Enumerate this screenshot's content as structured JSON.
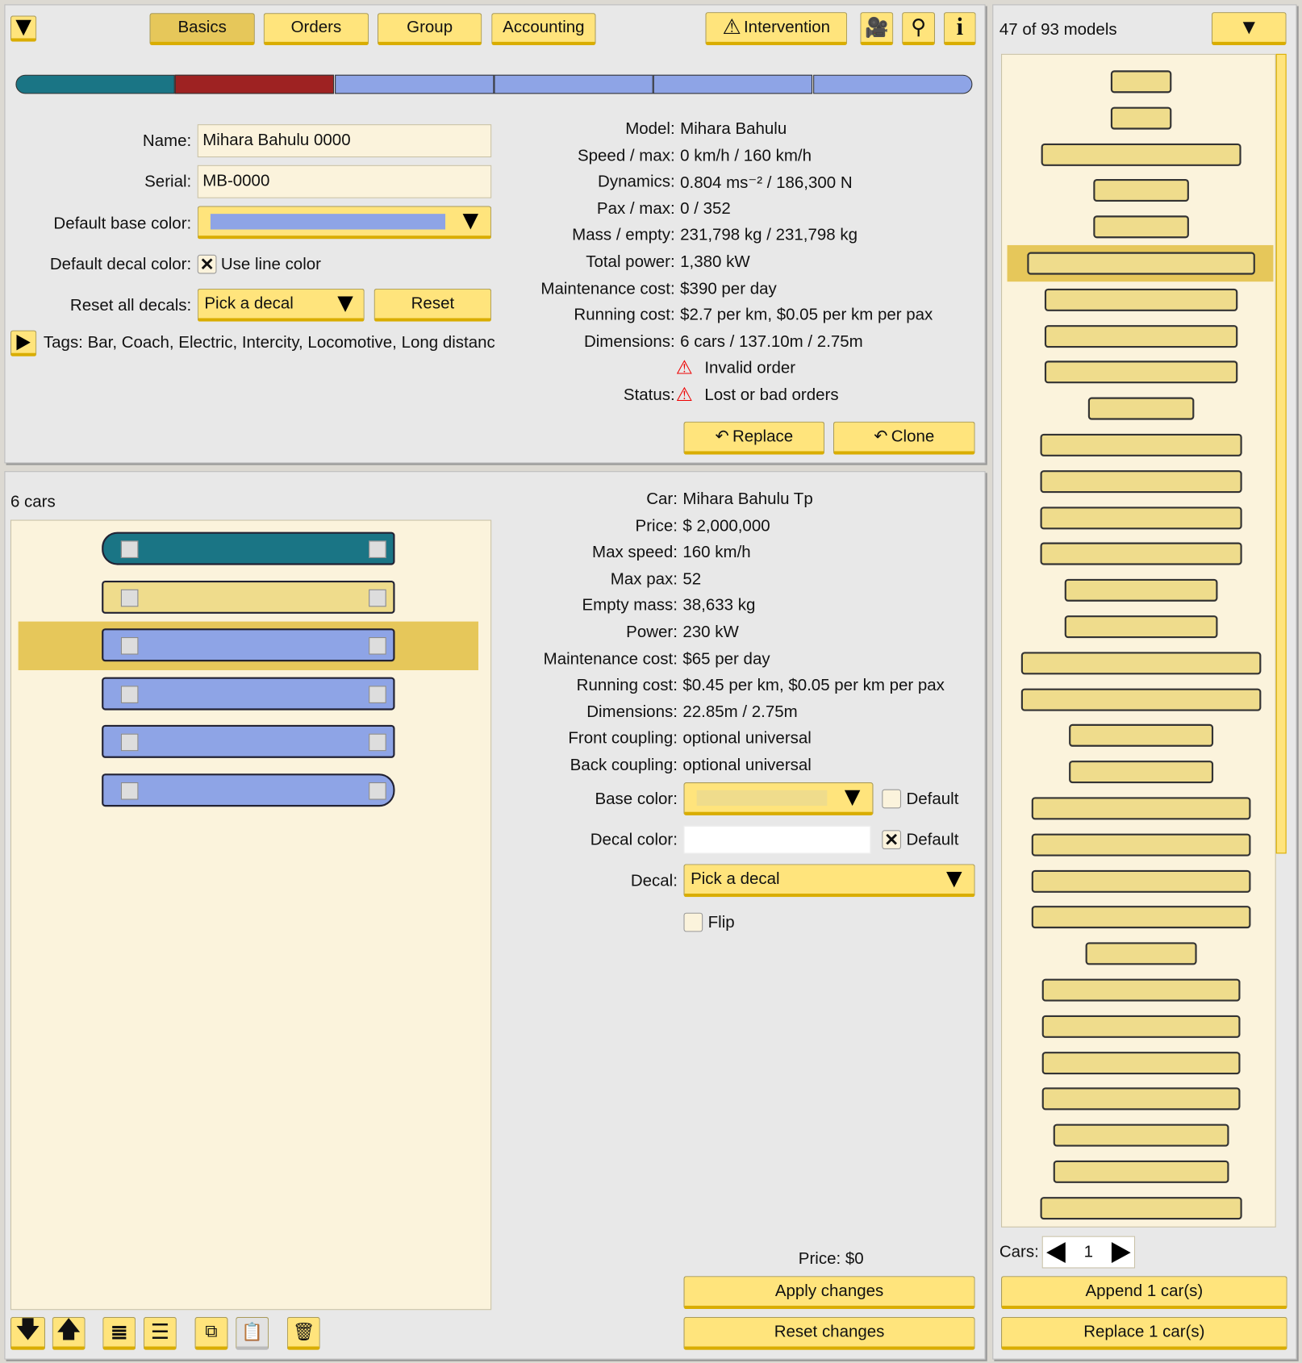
{
  "tabs": [
    {
      "label": "Basics",
      "active": true
    },
    {
      "label": "Orders"
    },
    {
      "label": "Group"
    },
    {
      "label": "Accounting"
    }
  ],
  "toolbar": {
    "intervention": "Intervention",
    "icons": [
      "triangle-down-icon",
      "warning-icon",
      "camera-icon",
      "map-pin-icon",
      "info-icon"
    ]
  },
  "consist_colors": [
    "#1a7585",
    "#9e2222",
    "#8ea4e6",
    "#8ea4e6",
    "#8ea4e6",
    "#8ea4e6"
  ],
  "form": {
    "name_label": "Name:",
    "name_value": "Mihara Bahulu 0000",
    "serial_label": "Serial:",
    "serial_value": "MB-0000",
    "base_color_label": "Default base color:",
    "base_color": "#8ea4e6",
    "decal_color_label": "Default decal color:",
    "use_line_color": "Use line color",
    "use_line_color_checked": true,
    "reset_decals_label": "Reset all decals:",
    "pick_decal": "Pick a decal",
    "reset": "Reset",
    "tags": "Tags: Bar, Coach, Electric, Intercity, Locomotive, Long distanc"
  },
  "train_info": [
    {
      "label": "Model:",
      "value": "Mihara Bahulu"
    },
    {
      "label": "Speed / max:",
      "value": "0 km/h / 160 km/h"
    },
    {
      "label": "Dynamics:",
      "value": "0.804 ms⁻² / 186,300 N"
    },
    {
      "label": "Pax / max:",
      "value": "0 / 352"
    },
    {
      "label": "Mass / empty:",
      "value": "231,798 kg / 231,798 kg"
    },
    {
      "label": "Total power:",
      "value": "1,380 kW"
    },
    {
      "label": "Maintenance cost:",
      "value": "$390 per day"
    },
    {
      "label": "Running cost:",
      "value": "$2.7 per km, $0.05 per km per pax"
    },
    {
      "label": "Dimensions:",
      "value": "6 cars / 137.10m / 2.75m"
    }
  ],
  "status": {
    "label": "Status:",
    "items": [
      "Invalid order",
      "Lost or bad orders"
    ]
  },
  "actions": {
    "replace": "Replace",
    "clone": "Clone"
  },
  "cars": {
    "count_label": "6 cars",
    "selected": 1,
    "colors": [
      "#1a7585",
      "#efdc8c",
      "#8ea4e6",
      "#8ea4e6",
      "#8ea4e6",
      "#8ea4e6"
    ]
  },
  "car_info": [
    {
      "label": "Car:",
      "value": "Mihara Bahulu Tp"
    },
    {
      "label": "Price:",
      "value": "$ 2,000,000"
    },
    {
      "label": "Max speed:",
      "value": "160 km/h"
    },
    {
      "label": "Max pax:",
      "value": "52"
    },
    {
      "label": "Empty mass:",
      "value": "38,633 kg"
    },
    {
      "label": "Power:",
      "value": "230 kW"
    },
    {
      "label": "Maintenance cost:",
      "value": "$65 per day"
    },
    {
      "label": "Running cost:",
      "value": "$0.45 per km, $0.05 per km per pax"
    },
    {
      "label": "Dimensions:",
      "value": "22.85m / 2.75m"
    },
    {
      "label": "Front coupling:",
      "value": "optional universal"
    },
    {
      "label": "Back coupling:",
      "value": "optional universal"
    }
  ],
  "car_edit": {
    "base_color_label": "Base color:",
    "base_color": "#efdc8c",
    "default": "Default",
    "base_default_checked": false,
    "decal_color_label": "Decal color:",
    "decal_default_checked": true,
    "decal_label": "Decal:",
    "pick_decal": "Pick a decal",
    "flip": "Flip"
  },
  "footer": {
    "price": "Price: $0",
    "apply": "Apply changes",
    "reset": "Reset changes"
  },
  "models": {
    "count": "47 of 93 models",
    "selected": 5,
    "cars_label": "Cars:",
    "cars_value": "1",
    "append": "Append 1 car(s)",
    "replace": "Replace 1 car(s)"
  }
}
